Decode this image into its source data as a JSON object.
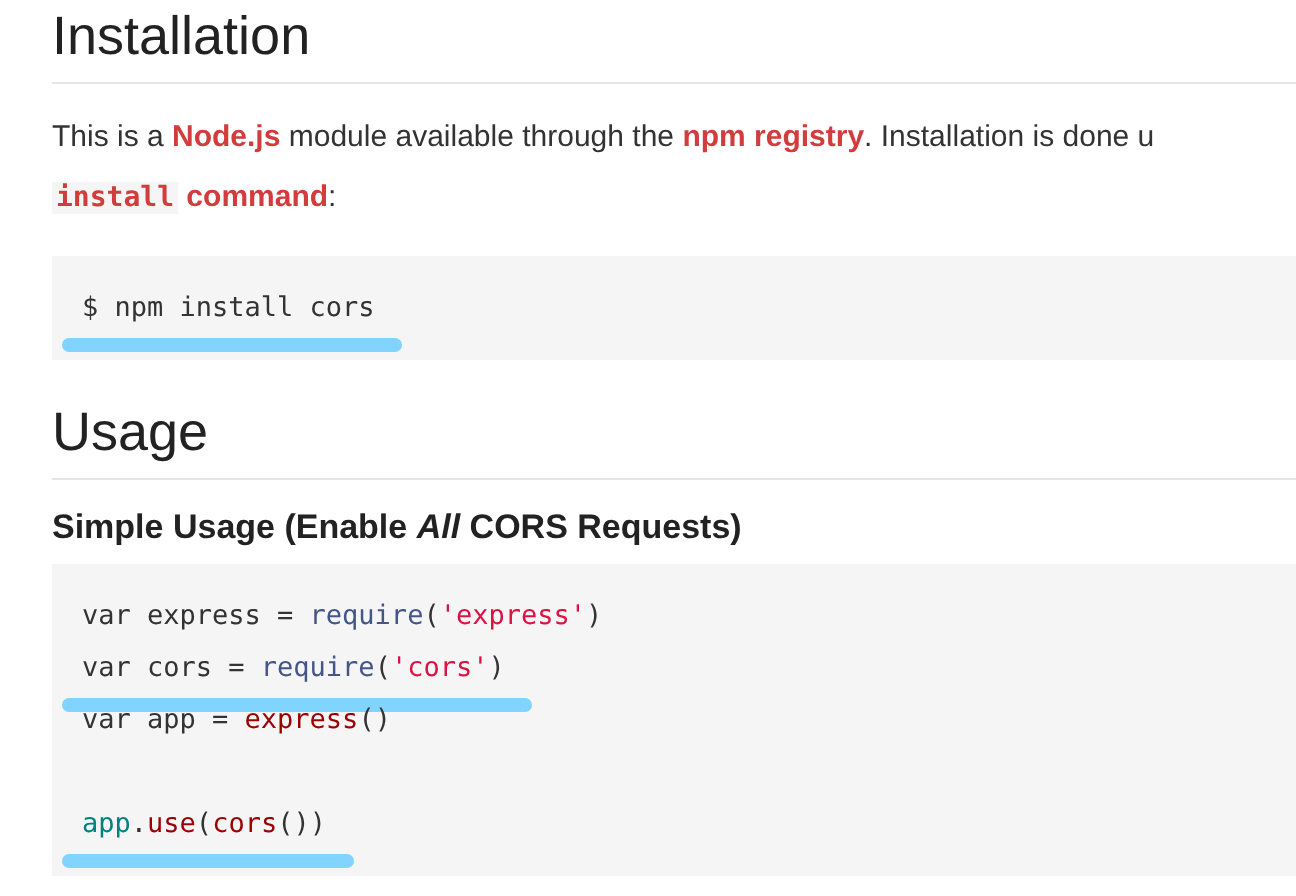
{
  "sections": [
    {
      "heading": "Installation",
      "blocks": [
        {
          "kind": "paragraph",
          "lines": [
            [
              {
                "kind": "text",
                "text": "This is a "
              },
              {
                "kind": "link",
                "text": "Node.js"
              },
              {
                "kind": "text",
                "text": " module available through the "
              },
              {
                "kind": "link",
                "text": "npm registry"
              },
              {
                "kind": "text",
                "text": ". Installation is done u"
              }
            ],
            [
              {
                "kind": "code_link",
                "code": "install",
                "text": " command"
              },
              {
                "kind": "text",
                "text": ":"
              }
            ]
          ]
        },
        {
          "kind": "code",
          "groups": [
            [
              {
                "highlighted": true,
                "tokens": [
                  {
                    "kind": "plain",
                    "text": "$ npm install cors"
                  }
                ]
              }
            ]
          ]
        }
      ]
    },
    {
      "heading": "Usage",
      "blocks": [
        {
          "kind": "subheading",
          "text": "Simple Usage (Enable *All* CORS Requests)"
        },
        {
          "kind": "code",
          "groups": [
            [
              {
                "highlighted": false,
                "tokens": [
                  {
                    "kind": "plain",
                    "text": "var express = "
                  },
                  {
                    "kind": "builtin",
                    "text": "require"
                  },
                  {
                    "kind": "plain",
                    "text": "("
                  },
                  {
                    "kind": "string",
                    "text": "'express'"
                  },
                  {
                    "kind": "plain",
                    "text": ")"
                  }
                ]
              },
              {
                "highlighted": true,
                "tokens": [
                  {
                    "kind": "plain",
                    "text": "var cors = "
                  },
                  {
                    "kind": "builtin",
                    "text": "require"
                  },
                  {
                    "kind": "plain",
                    "text": "("
                  },
                  {
                    "kind": "string",
                    "text": "'cors'"
                  },
                  {
                    "kind": "plain",
                    "text": ")"
                  }
                ]
              },
              {
                "highlighted": false,
                "tokens": [
                  {
                    "kind": "plain",
                    "text": "var app = "
                  },
                  {
                    "kind": "call",
                    "text": "express"
                  },
                  {
                    "kind": "plain",
                    "text": "()"
                  }
                ]
              }
            ],
            [
              {
                "highlighted": true,
                "tokens": [
                  {
                    "kind": "object",
                    "text": "app"
                  },
                  {
                    "kind": "plain",
                    "text": "."
                  },
                  {
                    "kind": "call",
                    "text": "use"
                  },
                  {
                    "kind": "plain",
                    "text": "("
                  },
                  {
                    "kind": "call",
                    "text": "cors"
                  },
                  {
                    "kind": "plain",
                    "text": "())"
                  }
                ]
              }
            ]
          ]
        }
      ]
    }
  ]
}
